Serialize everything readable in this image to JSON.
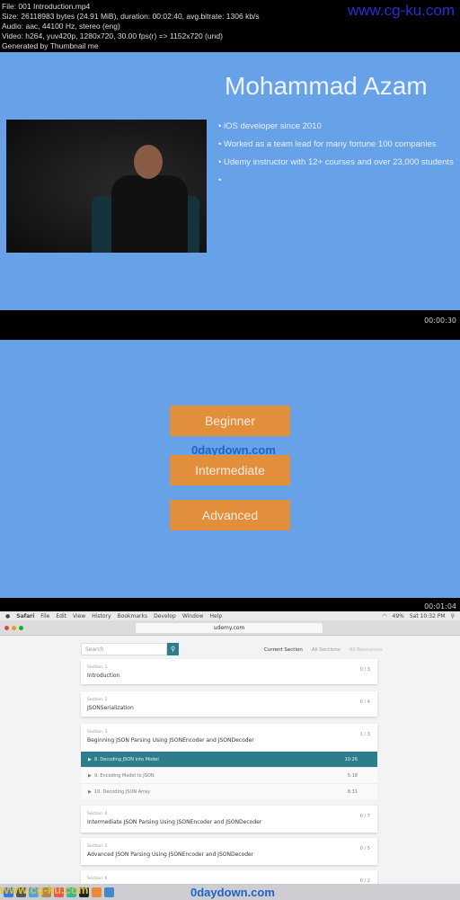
{
  "header": {
    "lines": [
      "File: 001 Introduction.mp4",
      "Size: 26118983 bytes (24.91 MiB), duration: 00:02:40, avg.bitrate: 1306 kb/s",
      "Audio: aac, 44100 Hz, stereo (eng)",
      "Video: h264, yuv420p, 1280x720, 30.00 fps(r) => 1152x720 (und)",
      "Generated by Thumbnail me"
    ],
    "watermark": "www.cg-ku.com"
  },
  "frame1": {
    "name": "Mohammad Azam",
    "bullets": [
      "iOS developer since 2010",
      "Worked as a team lead for many fortune 100 companies",
      "Udemy instructor with 12+ courses and over 23,000 students",
      ""
    ],
    "timestamp": "00:00:30"
  },
  "frame2": {
    "levels": [
      "Beginner",
      "Intermediate",
      "Advanced"
    ],
    "watermark": "0daydown.com",
    "timestamp": "00:01:04"
  },
  "frame3": {
    "menubar": {
      "app": "Safari",
      "items": [
        "File",
        "Edit",
        "View",
        "History",
        "Bookmarks",
        "Develop",
        "Window",
        "Help"
      ],
      "battery": "49%",
      "clock": "Sat 10:32 PM"
    },
    "url": "udemy.com",
    "search_placeholder": "Search",
    "tabs": [
      "Current Section",
      "All Sections",
      "All Resources"
    ],
    "sections": [
      {
        "label": "Section: 1",
        "title": "Introduction",
        "count": "0 / 3"
      },
      {
        "label": "Section: 2",
        "title": "JSONSerialization",
        "count": "0 / 4"
      },
      {
        "label": "Section: 3",
        "title": "Beginning JSON Parsing Using JSONEncoder and JSONDecoder",
        "count": "1 / 3"
      },
      {
        "label": "Section: 4",
        "title": "Intermediate JSON Parsing Using JSONEncoder and JSONDecoder",
        "count": "0 / 7"
      },
      {
        "label": "Section: 5",
        "title": "Advanced JSON Parsing Using JSONEncoder and JSONDecoder",
        "count": "0 / 5"
      },
      {
        "label": "Section: 6",
        "title": "",
        "count": "0 / 2"
      }
    ],
    "lectures": [
      {
        "title": "8.  Decoding JSON into Model",
        "duration": "10:26"
      },
      {
        "title": "9.  Encoding Model to JSON",
        "duration": "5:18"
      },
      {
        "title": "10.  Decoding JSON Array",
        "duration": "8:31"
      }
    ],
    "watermarks": [
      "www.cg-ku.com",
      "0daydown.com"
    ]
  },
  "colors": {
    "slide_bg": "#67a1e8",
    "button": "#e28f3b",
    "udemy_teal": "#2e7d8c"
  }
}
